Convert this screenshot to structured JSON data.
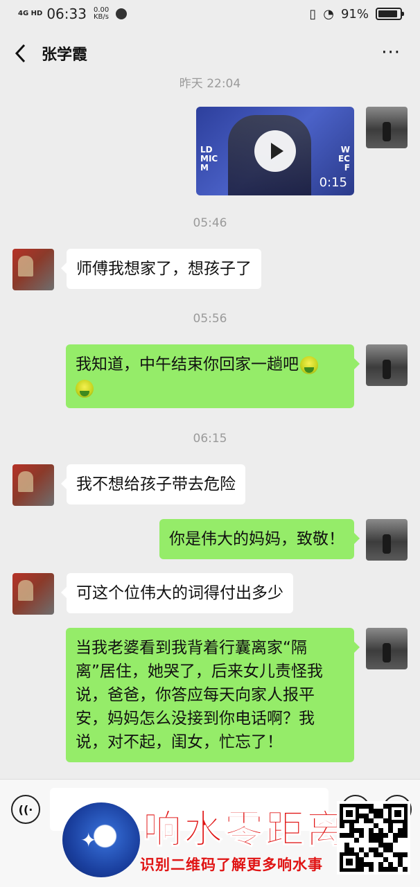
{
  "status_bar": {
    "network": "4G HD",
    "time": "06:33",
    "speed_value": "0.00",
    "speed_unit": "KB/s",
    "battery": "91%"
  },
  "nav": {
    "title": "张学霞",
    "more": "···"
  },
  "messages": {
    "time_yesterday": "昨天 22:04",
    "video_duration": "0:15",
    "video_left_text": "LD\nMIC\nM",
    "video_right_text": "W\nEC\nF",
    "time_0546": "05:46",
    "msg1": "师傅我想家了，想孩子了",
    "time_0556": "05:56",
    "msg2": "我知道，中午结束你回家一趟吧",
    "time_0615": "06:15",
    "msg3": "我不想给孩子带去危险",
    "msg4": "你是伟大的妈妈，致敬！",
    "msg5": "可这个位伟大的词得付出多少",
    "msg6": "当我老婆看到我背着行囊离家“隔离”居住，她哭了，后来女儿责怪我说，爸爸，你答应每天向家人报平安，妈妈怎么没接到你电话啊？我说，对不起，闺女，忙忘了！"
  },
  "watermark": {
    "title": "响水零距离",
    "subtitle": "识别二维码了解更多响水事"
  },
  "colors": {
    "incoming_bubble": "#ffffff",
    "outgoing_bubble": "#95ec69",
    "background": "#ededed",
    "watermark_red": "#e01414"
  }
}
